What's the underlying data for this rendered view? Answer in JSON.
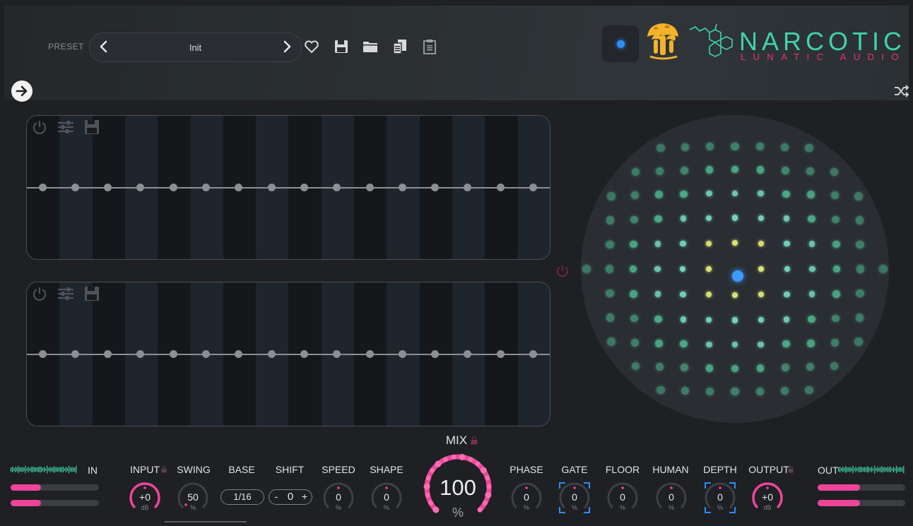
{
  "header": {
    "preset_label": "PRESET",
    "preset_name": "Init",
    "brand_name": "NARCOTIC",
    "brand_sub": "LUNATIC AUDIO",
    "icons": [
      "heart-icon",
      "save-icon",
      "folder-icon",
      "copy-icon",
      "paste-icon",
      "arrow-right-icon",
      "shuffle-icon"
    ]
  },
  "sequencers": [
    {
      "name": "sequencer-1",
      "steps": 16
    },
    {
      "name": "sequencer-2",
      "steps": 16
    }
  ],
  "controls": {
    "mix": {
      "label": "MIX",
      "value": "100",
      "unit": "%",
      "fraction": 1.0
    },
    "input": {
      "label": "INPUT",
      "value": "+0",
      "unit": "dB"
    },
    "swing": {
      "label": "SWING",
      "value": "50",
      "unit": "%"
    },
    "base": {
      "label": "BASE",
      "value": "1/16"
    },
    "shift": {
      "label": "SHIFT",
      "value": "0",
      "minus": "-",
      "plus": "+"
    },
    "speed": {
      "label": "SPEED",
      "value": "0",
      "unit": "%"
    },
    "shape": {
      "label": "SHAPE",
      "value": "0",
      "unit": "%"
    },
    "phase": {
      "label": "PHASE",
      "value": "0",
      "unit": "%"
    },
    "gate": {
      "label": "GATE",
      "value": "0",
      "unit": "%"
    },
    "floor": {
      "label": "FLOOR",
      "value": "0",
      "unit": "%"
    },
    "human": {
      "label": "HUMAN",
      "value": "0",
      "unit": "%"
    },
    "depth": {
      "label": "DEPTH",
      "value": "0",
      "unit": "%"
    },
    "output": {
      "label": "OUTPUT",
      "value": "+0",
      "unit": "dB"
    }
  },
  "meters": {
    "in_label": "IN",
    "out_label": "OUT",
    "in_levels": [
      0.34,
      0.34
    ],
    "out_levels": [
      0.48,
      0.48
    ]
  },
  "colors": {
    "accent_pink": "#f0449a",
    "brand_green": "#3fd4a8",
    "led_blue": "#2f8cff",
    "dot_green": "#57d6a2",
    "dot_yellow": "#e8f27a"
  }
}
